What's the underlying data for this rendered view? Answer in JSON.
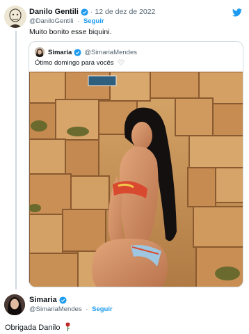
{
  "tweet": {
    "author": {
      "name": "Danilo Gentili",
      "handle": "@DaniloGentili",
      "avatar_icon": "caricature-avatar"
    },
    "date": "12 de dez de 2022",
    "separator": "·",
    "follow_label": "Seguir",
    "text": "Muito bonito esse biquini.",
    "brand_icon": "twitter-bird-icon"
  },
  "quoted_tweet": {
    "author": {
      "name": "Simaria",
      "handle": "@SimariaMendes"
    },
    "text": "Ótimo domingo para vocês",
    "emoji_icon": "white-heart-icon",
    "photo_icon": "photo-woman-stone-wall"
  },
  "reply": {
    "author": {
      "name": "Simaria",
      "handle": "@SimariaMendes"
    },
    "separator": "·",
    "follow_label": "Seguir",
    "text": "Obrigada Danilo",
    "emoji_icon": "rose-icon"
  },
  "colors": {
    "accent": "#1d9bf0",
    "secondary_text": "#536471",
    "border": "#cfd9de"
  }
}
